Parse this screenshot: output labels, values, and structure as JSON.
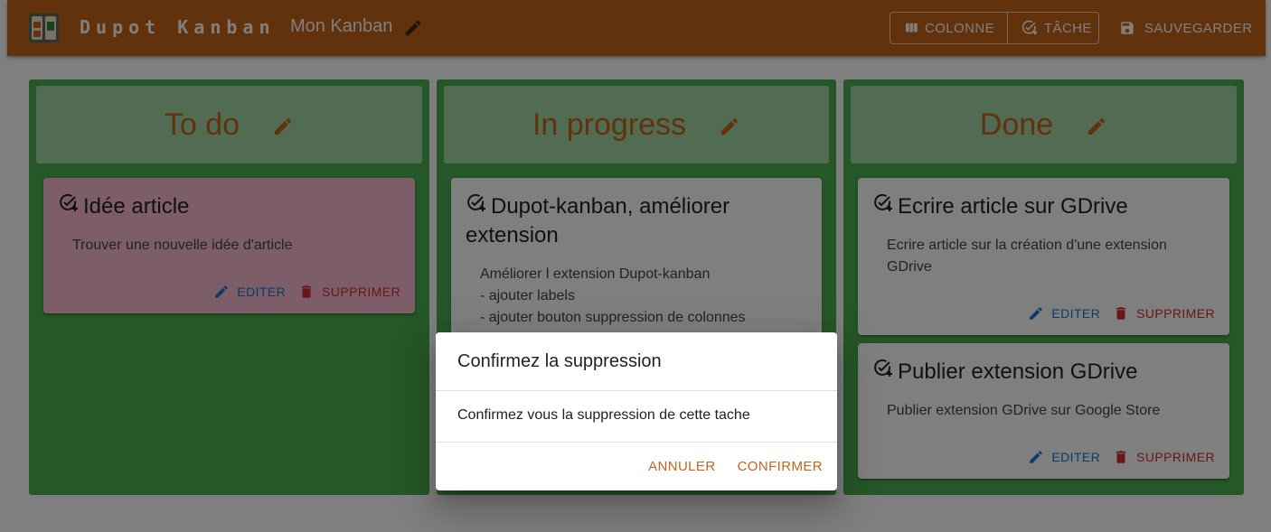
{
  "app": {
    "brand": "Dupot Kanban",
    "board_name": "Mon Kanban"
  },
  "toolbar": {
    "column_label": "Colonne",
    "task_label": "Tâche",
    "save_label": "Sauvegarder"
  },
  "colors": {
    "accent": "#c5641b",
    "column_bg": "#4caf50",
    "column_header_bg": "#a5d6a7",
    "card_pink": "#f8bbd0"
  },
  "columns": [
    {
      "title": "To do",
      "cards": [
        {
          "title": "Idée article",
          "description": "Trouver une nouvelle idée d'article",
          "edit_label": "Editer",
          "delete_label": "Supprimer",
          "color": "pink"
        }
      ]
    },
    {
      "title": "In progress",
      "cards": [
        {
          "title": "Dupot-kanban, améliorer extension",
          "description": "Améliorer l extension Dupot-kanban\n- ajouter labels\n- ajouter bouton suppression de colonnes"
        }
      ]
    },
    {
      "title": "Done",
      "cards": [
        {
          "title": "Ecrire article sur GDrive",
          "description": "Ecrire article sur la création d'une extension GDrive",
          "edit_label": "Editer",
          "delete_label": "Supprimer"
        },
        {
          "title": "Publier extension GDrive",
          "description": "Publier extension GDrive sur Google Store",
          "edit_label": "Editer",
          "delete_label": "Supprimer"
        }
      ]
    }
  ],
  "dialog": {
    "title": "Confirmez la suppression",
    "body": "Confirmez vous la suppression de cette tache",
    "cancel_label": "Annuler",
    "confirm_label": "Confirmer"
  }
}
